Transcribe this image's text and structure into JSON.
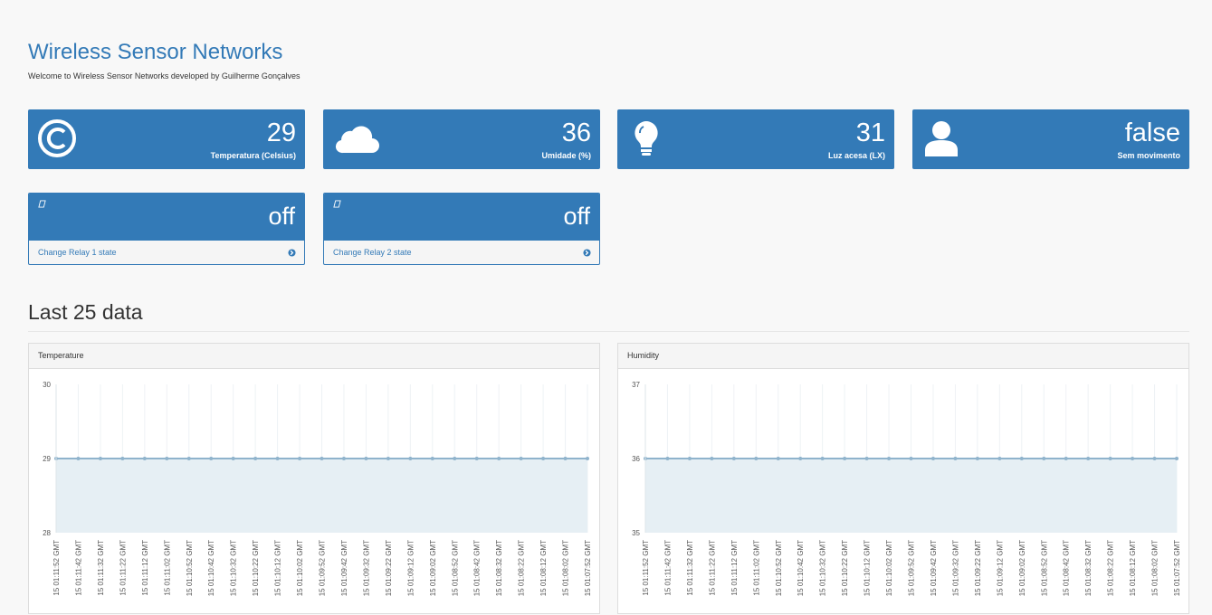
{
  "header": {
    "title": "Wireless Sensor Networks",
    "subtitle": "Welcome to Wireless Sensor Networks developed by Guilherme Gonçalves"
  },
  "stats": [
    {
      "value": "29",
      "label": "Temperatura (Celsius)",
      "icon": "copyright-icon"
    },
    {
      "value": "36",
      "label": "Umidade (%)",
      "icon": "cloud-icon"
    },
    {
      "value": "31",
      "label": "Luz acesa (LX)",
      "icon": "lightbulb-icon"
    },
    {
      "value": "false",
      "label": "Sem movimento",
      "icon": "user-icon"
    }
  ],
  "relays": [
    {
      "state": "off",
      "action": "Change Relay 1 state",
      "icon": "off-icon"
    },
    {
      "state": "off",
      "action": "Change Relay 2 state",
      "icon": "off-icon"
    }
  ],
  "section": {
    "title": "Last 25 data"
  },
  "colors": {
    "primary": "#337ab7",
    "line": "#8fb3cc",
    "area": "#e6eff4"
  },
  "chart_data": [
    {
      "type": "area",
      "title": "Temperature",
      "ylim": [
        28,
        30
      ],
      "yticks": [
        "30",
        "29",
        "28"
      ],
      "x": [
        "15 01:11:52 GMT",
        "15 01:11:42 GMT",
        "15 01:11:32 GMT",
        "15 01:11:22 GMT",
        "15 01:11:12 GMT",
        "15 01:11:02 GMT",
        "15 01:10:52 GMT",
        "15 01:10:42 GMT",
        "15 01:10:32 GMT",
        "15 01:10:22 GMT",
        "15 01:10:12 GMT",
        "15 01:10:02 GMT",
        "15 01:09:52 GMT",
        "15 01:09:42 GMT",
        "15 01:09:32 GMT",
        "15 01:09:22 GMT",
        "15 01:09:12 GMT",
        "15 01:09:02 GMT",
        "15 01:08:52 GMT",
        "15 01:08:42 GMT",
        "15 01:08:32 GMT",
        "15 01:08:22 GMT",
        "15 01:08:12 GMT",
        "15 01:08:02 GMT",
        "15 01:07:52 GMT"
      ],
      "values": [
        29,
        29,
        29,
        29,
        29,
        29,
        29,
        29,
        29,
        29,
        29,
        29,
        29,
        29,
        29,
        29,
        29,
        29,
        29,
        29,
        29,
        29,
        29,
        29,
        29
      ],
      "grid": true
    },
    {
      "type": "area",
      "title": "Humidity",
      "ylim": [
        35,
        37
      ],
      "yticks": [
        "37",
        "36",
        "35"
      ],
      "x": [
        "15 01:11:52 GMT",
        "15 01:11:42 GMT",
        "15 01:11:32 GMT",
        "15 01:11:22 GMT",
        "15 01:11:12 GMT",
        "15 01:11:02 GMT",
        "15 01:10:52 GMT",
        "15 01:10:42 GMT",
        "15 01:10:32 GMT",
        "15 01:10:22 GMT",
        "15 01:10:12 GMT",
        "15 01:10:02 GMT",
        "15 01:09:52 GMT",
        "15 01:09:42 GMT",
        "15 01:09:32 GMT",
        "15 01:09:22 GMT",
        "15 01:09:12 GMT",
        "15 01:09:02 GMT",
        "15 01:08:52 GMT",
        "15 01:08:42 GMT",
        "15 01:08:32 GMT",
        "15 01:08:22 GMT",
        "15 01:08:12 GMT",
        "15 01:08:02 GMT",
        "15 01:07:52 GMT"
      ],
      "values": [
        36,
        36,
        36,
        36,
        36,
        36,
        36,
        36,
        36,
        36,
        36,
        36,
        36,
        36,
        36,
        36,
        36,
        36,
        36,
        36,
        36,
        36,
        36,
        36,
        36
      ],
      "grid": true
    }
  ]
}
